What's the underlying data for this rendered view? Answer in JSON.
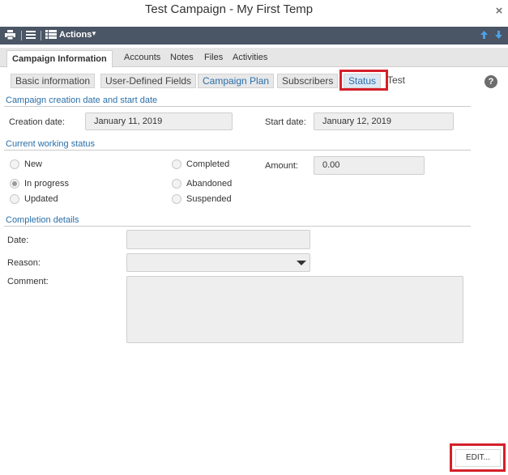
{
  "window": {
    "title": "Test Campaign - My First Temp",
    "close_glyph": "×"
  },
  "toolbar": {
    "actions_label": "Actions"
  },
  "main_tabs": [
    "Campaign Information",
    "Accounts",
    "Notes",
    "Files",
    "Activities"
  ],
  "sub_tabs": [
    "Basic information",
    "User-Defined Fields",
    "Campaign Plan",
    "Subscribers",
    "Status",
    "Test"
  ],
  "help_glyph": "?",
  "sections": {
    "dates": {
      "title": "Campaign creation date and start date",
      "creation_label": "Creation date:",
      "creation_value": "January 11, 2019",
      "start_label": "Start date:",
      "start_value": "January 12, 2019"
    },
    "status": {
      "title": "Current working status",
      "options": [
        "New",
        "In progress",
        "Updated",
        "Completed",
        "Abandoned",
        "Suspended"
      ],
      "selected": "In progress",
      "amount_label": "Amount:",
      "amount_value": "0.00"
    },
    "completion": {
      "title": "Completion details",
      "date_label": "Date:",
      "date_value": "",
      "reason_label": "Reason:",
      "reason_value": "",
      "comment_label": "Comment:",
      "comment_value": ""
    }
  },
  "footer": {
    "edit_label": "EDIT..."
  },
  "colors": {
    "toolbar": "#4a5565",
    "section_title": "#2a6fa8",
    "highlight": "#d4202a"
  }
}
